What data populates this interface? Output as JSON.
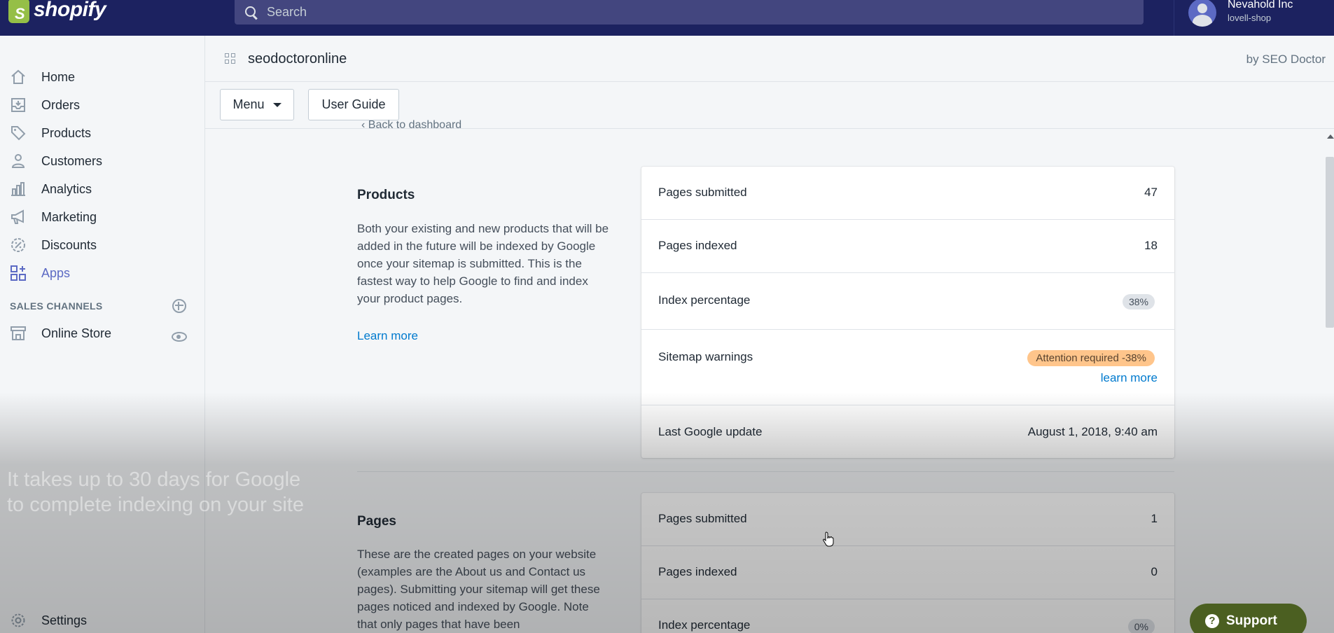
{
  "topbar": {
    "brand": "shopify",
    "search_placeholder": "Search",
    "account_name": "Nevahold Inc",
    "account_shop": "lovell-shop"
  },
  "sidebar": {
    "items": [
      {
        "label": "Home",
        "icon": "home-icon"
      },
      {
        "label": "Orders",
        "icon": "orders-icon"
      },
      {
        "label": "Products",
        "icon": "tag-icon"
      },
      {
        "label": "Customers",
        "icon": "person-icon"
      },
      {
        "label": "Analytics",
        "icon": "bar-chart-icon"
      },
      {
        "label": "Marketing",
        "icon": "megaphone-icon"
      },
      {
        "label": "Discounts",
        "icon": "discount-icon"
      },
      {
        "label": "Apps",
        "icon": "apps-icon"
      }
    ],
    "sales_channels_heading": "SALES CHANNELS",
    "online_store_label": "Online Store",
    "settings_label": "Settings"
  },
  "app": {
    "title": "seodoctoronline",
    "by": "by SEO Doctor",
    "menu_label": "Menu",
    "user_guide_label": "User Guide",
    "back_link": "‹ Back to dashboard"
  },
  "products": {
    "title": "Products",
    "description": "Both your existing and new products that will be added in the future will be indexed by Google once your sitemap is submitted. This is the fastest way to help Google to find and index your product pages.",
    "learn_more": "Learn more",
    "rows": {
      "submitted_label": "Pages submitted",
      "submitted_value": "47",
      "indexed_label": "Pages indexed",
      "indexed_value": "18",
      "percentage_label": "Index percentage",
      "percentage_value": "38%",
      "warnings_label": "Sitemap warnings",
      "warnings_badge": "Attention required -38%",
      "warnings_link": "learn more",
      "update_label": "Last Google update",
      "update_value": "August 1, 2018, 9:40 am"
    }
  },
  "pages": {
    "title": "Pages",
    "description": "These are the created pages on your website (examples are the About us and Contact us pages). Submitting your sitemap will get these pages noticed and indexed by Google. Note that only pages that have been",
    "rows": {
      "submitted_label": "Pages submitted",
      "submitted_value": "1",
      "indexed_label": "Pages indexed",
      "indexed_value": "0",
      "percentage_label": "Index percentage",
      "percentage_value": "0%"
    }
  },
  "overlay_caption": "It takes up to 30 days for Google to complete indexing on your site",
  "support": {
    "label": "Support"
  },
  "colors": {
    "topbar": "#1c2260",
    "accent": "#5c6ac4",
    "link": "#007ace",
    "warning_badge": "#ffc58b",
    "support_button": "#4b5f21"
  }
}
